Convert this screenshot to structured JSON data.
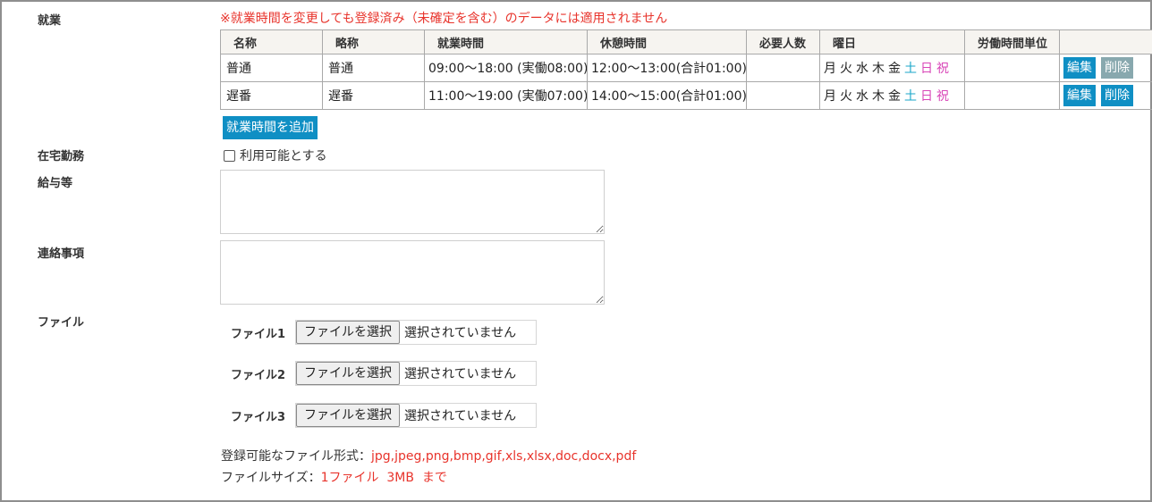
{
  "labels": {
    "shugyo": "就業",
    "zaitaku": "在宅勤務",
    "kyuyo": "給与等",
    "renraku": "連絡事項",
    "file": "ファイル"
  },
  "notice": "※就業時間を変更しても登録済み（未確定を含む）のデータには適用されません",
  "table": {
    "headers": [
      "名称",
      "略称",
      "就業時間",
      "休憩時間",
      "必要人数",
      "曜日",
      "労働時間単位",
      ""
    ],
    "rows": [
      {
        "name": "普通",
        "short": "普通",
        "work": "09:00〜18:00 (実働08:00)",
        "break": "12:00〜13:00(合計01:00)",
        "people": "",
        "unit": "",
        "edit": "編集",
        "delete": "削除",
        "delete_disabled": true
      },
      {
        "name": "遅番",
        "short": "遅番",
        "work": "11:00〜19:00 (実働07:00)",
        "break": "14:00〜15:00(合計01:00)",
        "people": "",
        "unit": "",
        "edit": "編集",
        "delete": "削除",
        "delete_disabled": false
      }
    ],
    "days": [
      "月",
      "火",
      "水",
      "木",
      "金",
      "土",
      "日",
      "祝"
    ]
  },
  "add_button": "就業時間を追加",
  "wfh_checkbox": {
    "label": "利用可能とする",
    "checked": false
  },
  "files": [
    {
      "label": "ファイル1",
      "button": "ファイルを選択",
      "status": "選択されていません"
    },
    {
      "label": "ファイル2",
      "button": "ファイルを選択",
      "status": "選択されていません"
    },
    {
      "label": "ファイル3",
      "button": "ファイルを選択",
      "status": "選択されていません"
    }
  ],
  "file_formats": {
    "prefix": "登録可能なファイル形式：",
    "value": "jpg,jpeg,png,bmp,gif,xls,xlsx,doc,docx,pdf"
  },
  "file_size": {
    "prefix": "ファイルサイズ：",
    "value": "1ファイル  3MB  まで"
  },
  "colors": {
    "accent": "#0f8fc4",
    "notice": "#e8342c",
    "saturday": "#1aa6c8",
    "sunday": "#d946b8"
  }
}
